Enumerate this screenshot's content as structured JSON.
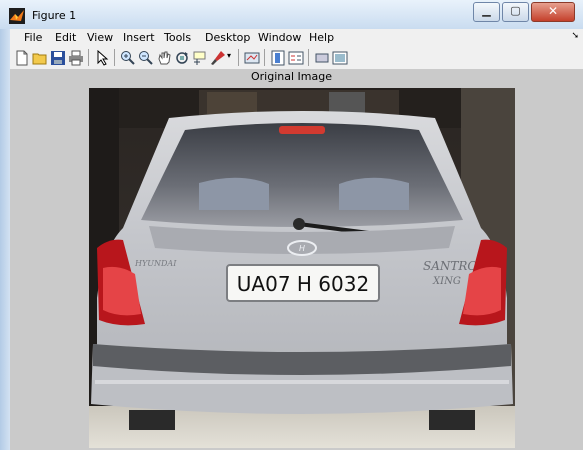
{
  "window": {
    "title": "Figure 1",
    "controls": [
      "minimize",
      "maximize",
      "close"
    ]
  },
  "menubar": {
    "items": [
      "File",
      "Edit",
      "View",
      "Insert",
      "Tools",
      "Desktop",
      "Window",
      "Help"
    ]
  },
  "toolbar": {
    "icons": [
      "new-figure-icon",
      "open-file-icon",
      "save-icon",
      "print-icon",
      "pointer-icon",
      "zoom-in-icon",
      "zoom-out-icon",
      "pan-icon",
      "rotate-3d-icon",
      "data-cursor-icon",
      "brush-icon",
      "link-plot-icon",
      "colorbar-icon",
      "legend-icon",
      "hide-plot-tools-icon",
      "show-plot-tools-icon"
    ]
  },
  "axes": {
    "title": "Original Image"
  },
  "photo": {
    "plate_text": "UA07 H 6032",
    "badge_text": "SANTRO",
    "badge_sub": "XING",
    "left_badge": "HYUNDAI"
  },
  "colors": {
    "title_bar": "#c9dcf0",
    "figure_bg": "#cacaca",
    "menu_bg": "#f0f0f0",
    "close_button": "#c4402b"
  }
}
